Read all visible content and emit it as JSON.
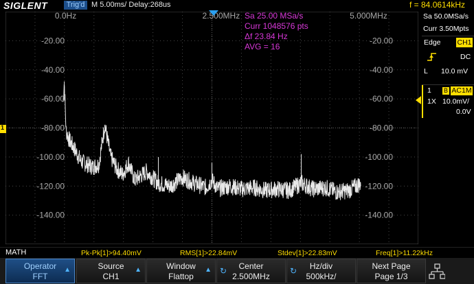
{
  "header": {
    "brand": "SIGLENT",
    "trig_status": "Trig'd",
    "timebase": "M 5.00ms/ Delay:268us",
    "freq_readout": "f = 84.0614kHz"
  },
  "screen": {
    "x_ticks": [
      "0.0Hz",
      "2.500MHz",
      "5.000MHz"
    ],
    "y_ticks_left": [
      "-20.00",
      "-40.00",
      "-60.00",
      "-80.00",
      "-100.00",
      "-120.00",
      "-140.00"
    ],
    "y_ticks_right": [
      "-20.00",
      "-40.00",
      "-60.00",
      "-80.00",
      "-100.00",
      "-120.00",
      "-140.00"
    ],
    "info": [
      "Sa 25.00 MSa/s",
      "Curr 1048576 pts",
      "Δf 23.84 Hz",
      "AVG = 16"
    ],
    "channel_marker": "1"
  },
  "right_panel": {
    "sample_rate": "Sa 50.0MSa/s",
    "curr_points": "Curr 3.50Mpts",
    "trigger_type": "Edge",
    "trigger_source": "CH1",
    "coupling": "DC",
    "level_label": "L",
    "level_value": "10.0 mV",
    "ch_number": "1",
    "ch_bw_badge": "B",
    "ch_coupling": "AC1M",
    "probe": "1X",
    "volts_div": "10.0mV/",
    "offset": "0.0V"
  },
  "math_bar": {
    "label": "MATH",
    "pkpk": "Pk-Pk[1]>94.40mV",
    "rms": "RMS[1]>22.84mV",
    "stdev": "Stdev[1]>22.83mV",
    "freq": "Freq[1]>11.22kHz"
  },
  "softkeys": [
    {
      "line1": "Operator",
      "line2": "FFT"
    },
    {
      "line1": "Source",
      "line2": "CH1"
    },
    {
      "line1": "Window",
      "line2": "Flattop"
    },
    {
      "line1": "Center",
      "line2": "2.500MHz"
    },
    {
      "line1": "Hz/div",
      "line2": "500kHz/"
    },
    {
      "line1": "Next Page",
      "line2": "Page 1/3"
    }
  ],
  "colors": {
    "trace": "#e8e8e8",
    "grid": "#4a4a4a",
    "accent_blue": "#1d4f8c",
    "channel_yellow": "#ffde00",
    "info_magenta": "#d838d8"
  },
  "chart_data": {
    "type": "line",
    "x_unit": "MHz",
    "y_unit": "dB",
    "xlim": [
      0,
      5
    ],
    "ylim": [
      -160,
      0
    ],
    "x": [
      0.0,
      0.02,
      0.05,
      0.1,
      0.2,
      0.3,
      0.5,
      0.6,
      0.7,
      0.8,
      0.9,
      1.0,
      1.1,
      1.2,
      1.4,
      1.6,
      1.8,
      2.0,
      2.2,
      2.4,
      2.5,
      2.6,
      2.8,
      3.0,
      3.2,
      3.4,
      3.6,
      3.8,
      4.0,
      4.2,
      4.4,
      4.6,
      4.8,
      5.0
    ],
    "y": [
      -62,
      -48,
      -82,
      -88,
      -95,
      -103,
      -107,
      -105,
      -78,
      -100,
      -108,
      -112,
      -104,
      -116,
      -110,
      -118,
      -120,
      -114,
      -118,
      -121,
      -116,
      -122,
      -120,
      -122,
      -121,
      -123,
      -122,
      -123,
      -118,
      -122,
      -121,
      -124,
      -123,
      -118
    ]
  }
}
